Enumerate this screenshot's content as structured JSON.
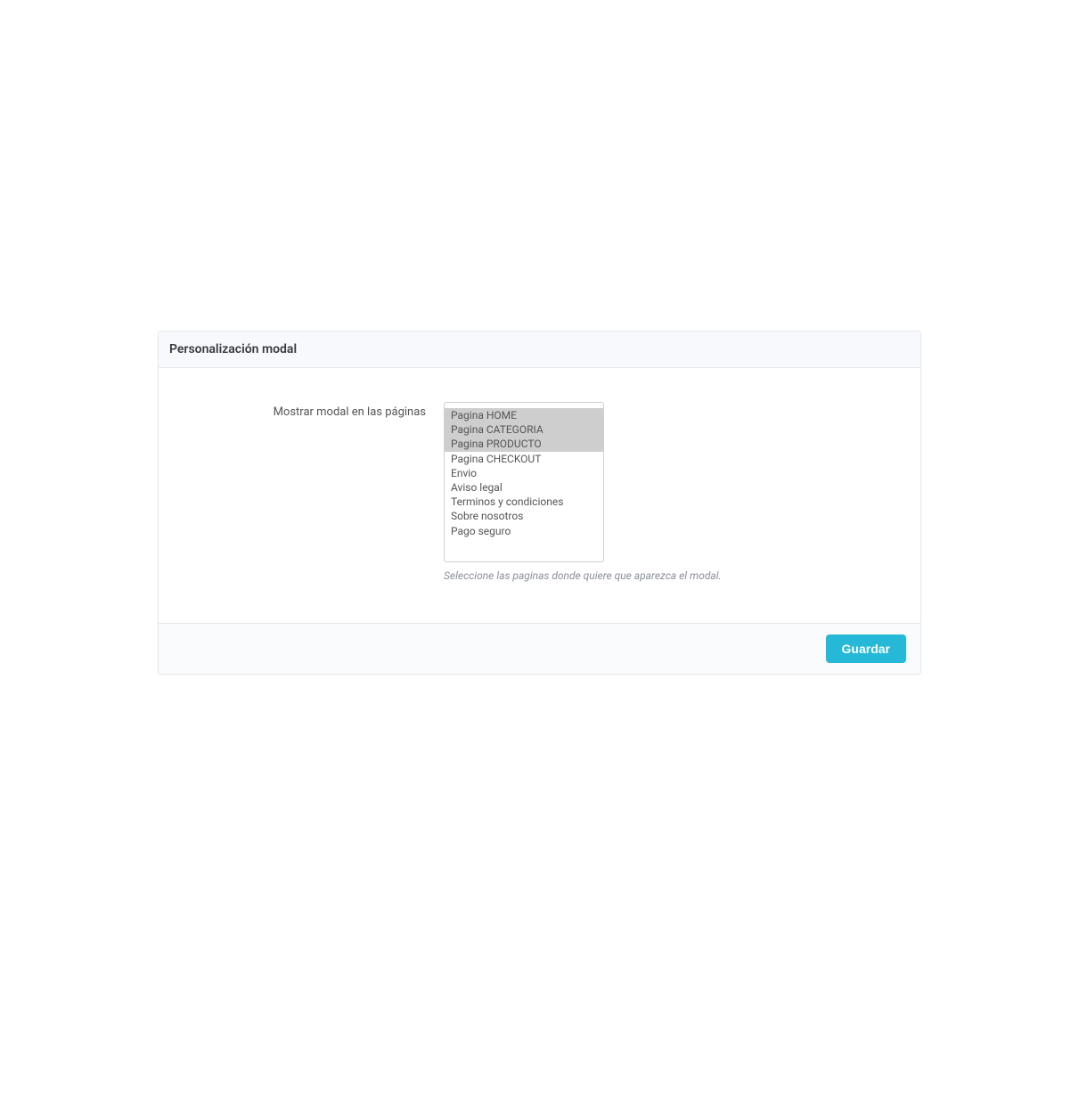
{
  "panel": {
    "title": "Personalización modal",
    "form": {
      "label": "Mostrar modal en las páginas",
      "options": [
        {
          "label": "Pagina HOME",
          "selected": true
        },
        {
          "label": "Pagina CATEGORIA",
          "selected": true
        },
        {
          "label": "Pagina PRODUCTO",
          "selected": true
        },
        {
          "label": "Pagina CHECKOUT",
          "selected": false
        },
        {
          "label": "Envio",
          "selected": false
        },
        {
          "label": "Aviso legal",
          "selected": false
        },
        {
          "label": "Terminos y condiciones",
          "selected": false
        },
        {
          "label": "Sobre nosotros",
          "selected": false
        },
        {
          "label": "Pago seguro",
          "selected": false
        }
      ],
      "help_text": "Seleccione las paginas donde quiere que aparezca el modal."
    },
    "save_button": "Guardar"
  }
}
